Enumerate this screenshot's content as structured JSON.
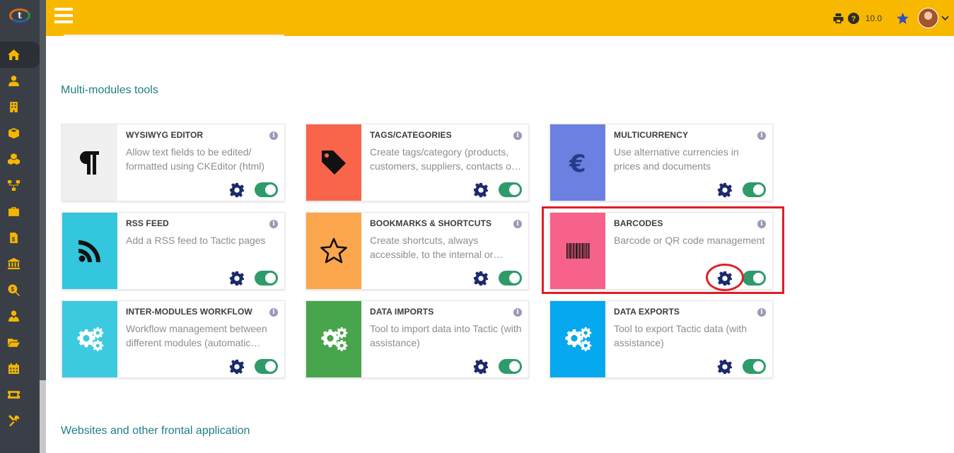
{
  "app": {
    "logo_letter": "t",
    "version": "10.0"
  },
  "sidebar": {
    "items": [
      {
        "icon": "home-icon",
        "active": true
      },
      {
        "icon": "user-icon"
      },
      {
        "icon": "building-icon"
      },
      {
        "icon": "box-icon"
      },
      {
        "icon": "cubes-icon"
      },
      {
        "icon": "workflow-icon"
      },
      {
        "icon": "briefcase-icon"
      },
      {
        "icon": "invoice-icon"
      },
      {
        "icon": "bank-icon"
      },
      {
        "icon": "search-money-icon"
      },
      {
        "icon": "user-tie-icon"
      },
      {
        "icon": "folder-open-icon"
      },
      {
        "icon": "calendar-icon"
      },
      {
        "icon": "ticket-icon"
      },
      {
        "icon": "tools-icon"
      }
    ]
  },
  "topbar": {
    "icons": [
      "print-icon",
      "help-icon",
      "star-icon",
      "avatar",
      "chevron-down-icon"
    ]
  },
  "sections": [
    {
      "title": "Multi-modules tools"
    },
    {
      "title": "Websites and other frontal application"
    }
  ],
  "colors": {
    "topbar": "#f9b800",
    "sidebar": "#3a3f47",
    "section_title": "#1f7e87",
    "toggle_on": "#2e9b6a",
    "gear": "#1b2a6b",
    "highlight": "#e01e26"
  },
  "modules": [
    {
      "title": "WYSIWYG EDITOR",
      "desc": "Allow text fields to be edited/ formatted using CKEditor (html)",
      "icon": "paragraph-icon",
      "color": "#f0f0f0",
      "enabled": true
    },
    {
      "title": "TAGS/CATEGORIES",
      "desc": "Create tags/category (products, customers, suppliers, contacts o…",
      "icon": "tag-icon",
      "color": "#f9654a",
      "enabled": true
    },
    {
      "title": "MULTICURRENCY",
      "desc": "Use alternative currencies in prices and documents",
      "icon": "euro-icon",
      "color": "#6b80e0",
      "enabled": true
    },
    {
      "title": "RSS FEED",
      "desc": "Add a RSS feed to Tactic pages",
      "icon": "rss-icon",
      "color": "#33c6dd",
      "enabled": true
    },
    {
      "title": "BOOKMARKS & SHORTCUTS",
      "desc": "Create shortcuts, always accessible, to the internal or…",
      "icon": "star-outline-icon",
      "color": "#fba64c",
      "enabled": true
    },
    {
      "title": "BARCODES",
      "desc": "Barcode or QR code management",
      "icon": "barcode-icon",
      "color": "#f7628a",
      "enabled": true,
      "highlighted": true
    },
    {
      "title": "INTER-MODULES WORKFLOW",
      "desc": "Workflow management between different modules (automatic…",
      "icon": "cogs-icon",
      "color": "#3ccae0",
      "enabled": true
    },
    {
      "title": "DATA IMPORTS",
      "desc": "Tool to import data into Tactic (with assistance)",
      "icon": "cogs-icon",
      "color": "#47a64c",
      "enabled": true
    },
    {
      "title": "DATA EXPORTS",
      "desc": "Tool to export Tactic data (with assistance)",
      "icon": "cogs-icon",
      "color": "#06a8ef",
      "enabled": true
    }
  ]
}
